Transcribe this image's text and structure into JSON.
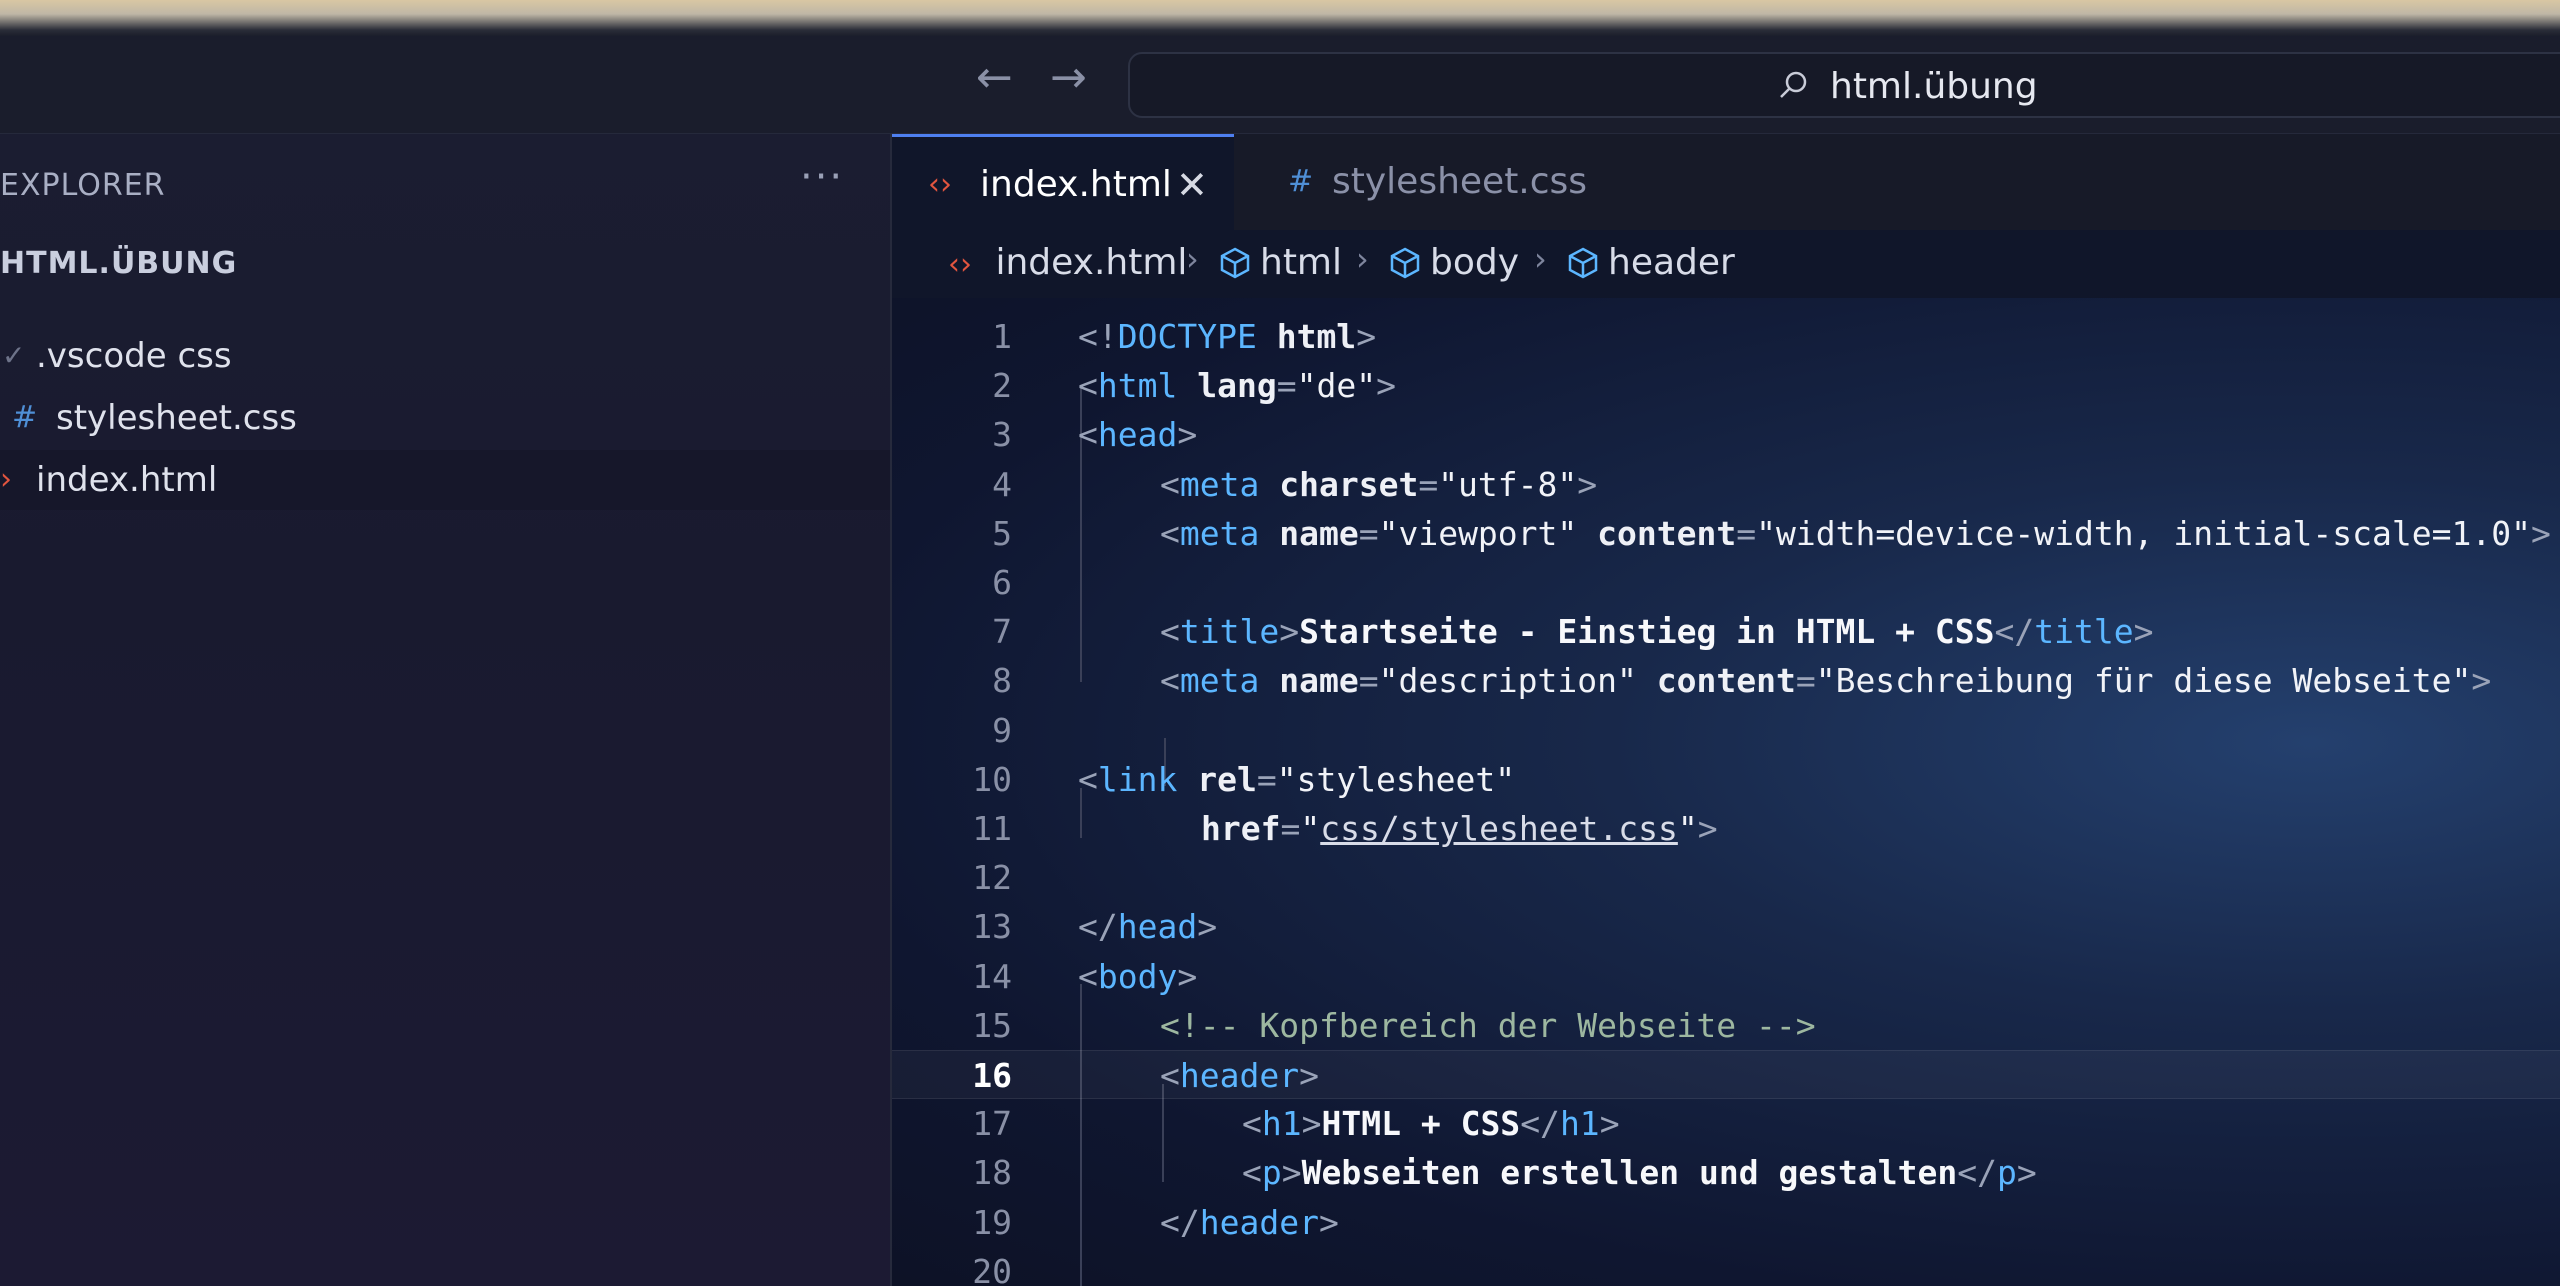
{
  "titlebar": {
    "search_text": "html.übung",
    "back_icon": "arrow-left-icon",
    "forward_icon": "arrow-right-icon"
  },
  "sidebar": {
    "header": "EXPLORER",
    "more": "···",
    "root": "HTML.ÜBUNG",
    "items": [
      {
        "label": ".vscode css",
        "icon": "folder-chevron-icon"
      },
      {
        "label": "stylesheet.css",
        "icon": "css-hash-icon"
      },
      {
        "label": "index.html",
        "icon": "html-icon"
      }
    ]
  },
  "tabs": [
    {
      "label": "index.html",
      "icon": "html-icon",
      "close": "✕",
      "active": true
    },
    {
      "label": "stylesheet.css",
      "icon": "css-hash-icon",
      "active": false
    }
  ],
  "breadcrumb": {
    "file": "index.html",
    "items": [
      "html",
      "body",
      "header"
    ]
  },
  "editor": {
    "current_line": 16,
    "lines": [
      {
        "n": "1",
        "indent": 0,
        "tokens": [
          [
            "p",
            "<!"
          ],
          [
            "tag",
            "DOCTYPE"
          ],
          [
            "p",
            " "
          ],
          [
            "attr",
            "html"
          ],
          [
            "p",
            ">"
          ]
        ]
      },
      {
        "n": "2",
        "indent": 0,
        "tokens": [
          [
            "p",
            "<"
          ],
          [
            "tag",
            "html"
          ],
          [
            "p",
            " "
          ],
          [
            "attr",
            "lang"
          ],
          [
            "p",
            "="
          ],
          [
            "str",
            "\"de\""
          ],
          [
            "p",
            ">"
          ]
        ]
      },
      {
        "n": "3",
        "indent": 0,
        "tokens": [
          [
            "p",
            "<"
          ],
          [
            "tag",
            "head"
          ],
          [
            "p",
            ">"
          ]
        ]
      },
      {
        "n": "4",
        "indent": 1,
        "tokens": [
          [
            "p",
            "<"
          ],
          [
            "tag",
            "meta"
          ],
          [
            "p",
            " "
          ],
          [
            "attr",
            "charset"
          ],
          [
            "p",
            "="
          ],
          [
            "str",
            "\"utf-8\""
          ],
          [
            "p",
            ">"
          ]
        ]
      },
      {
        "n": "5",
        "indent": 1,
        "tokens": [
          [
            "p",
            "<"
          ],
          [
            "tag",
            "meta"
          ],
          [
            "p",
            " "
          ],
          [
            "attr",
            "name"
          ],
          [
            "p",
            "="
          ],
          [
            "str",
            "\"viewport\""
          ],
          [
            "p",
            " "
          ],
          [
            "attr",
            "content"
          ],
          [
            "p",
            "="
          ],
          [
            "str",
            "\"width=device-width, initial-scale=1.0\""
          ],
          [
            "p",
            ">"
          ]
        ]
      },
      {
        "n": "6",
        "indent": 1,
        "tokens": []
      },
      {
        "n": "7",
        "indent": 1,
        "tokens": [
          [
            "p",
            "<"
          ],
          [
            "tag",
            "title"
          ],
          [
            "p",
            ">"
          ],
          [
            "txt",
            "Startseite - Einstieg in HTML + CSS"
          ],
          [
            "p",
            "</"
          ],
          [
            "tag",
            "title"
          ],
          [
            "p",
            ">"
          ]
        ]
      },
      {
        "n": "8",
        "indent": 1,
        "tokens": [
          [
            "p",
            "<"
          ],
          [
            "tag",
            "meta"
          ],
          [
            "p",
            " "
          ],
          [
            "attr",
            "name"
          ],
          [
            "p",
            "="
          ],
          [
            "str",
            "\"description\""
          ],
          [
            "p",
            " "
          ],
          [
            "attr",
            "content"
          ],
          [
            "p",
            "="
          ],
          [
            "str",
            "\"Beschreibung für diese Webseite\""
          ],
          [
            "p",
            ">"
          ]
        ]
      },
      {
        "n": "9",
        "indent": 1,
        "tokens": []
      },
      {
        "n": "10",
        "indent": 0,
        "tokens": [
          [
            "p",
            "<"
          ],
          [
            "tag",
            "link"
          ],
          [
            "p",
            " "
          ],
          [
            "attr",
            "rel"
          ],
          [
            "p",
            "="
          ],
          [
            "str",
            "\"stylesheet\""
          ]
        ]
      },
      {
        "n": "11",
        "indent": 1.5,
        "tokens": [
          [
            "attr",
            "href"
          ],
          [
            "p",
            "="
          ],
          [
            "str",
            "\""
          ],
          [
            "u",
            "css/stylesheet.css"
          ],
          [
            "str",
            "\""
          ],
          [
            "p",
            ">"
          ]
        ]
      },
      {
        "n": "12",
        "indent": 0,
        "tokens": []
      },
      {
        "n": "13",
        "indent": 0,
        "tokens": [
          [
            "p",
            "</"
          ],
          [
            "tag",
            "head"
          ],
          [
            "p",
            ">"
          ]
        ]
      },
      {
        "n": "14",
        "indent": 0,
        "tokens": [
          [
            "p",
            "<"
          ],
          [
            "tag",
            "body"
          ],
          [
            "p",
            ">"
          ]
        ]
      },
      {
        "n": "15",
        "indent": 1,
        "tokens": [
          [
            "cmt",
            "<!-- Kopfbereich der Webseite -->"
          ]
        ]
      },
      {
        "n": "16",
        "indent": 1,
        "tokens": [
          [
            "p",
            "<"
          ],
          [
            "tag",
            "header"
          ],
          [
            "p",
            ">"
          ]
        ]
      },
      {
        "n": "17",
        "indent": 2,
        "tokens": [
          [
            "p",
            "<"
          ],
          [
            "tag",
            "h1"
          ],
          [
            "p",
            ">"
          ],
          [
            "txt",
            "HTML + CSS"
          ],
          [
            "p",
            "</"
          ],
          [
            "tag",
            "h1"
          ],
          [
            "p",
            ">"
          ]
        ]
      },
      {
        "n": "18",
        "indent": 2,
        "tokens": [
          [
            "p",
            "<"
          ],
          [
            "tag",
            "p"
          ],
          [
            "p",
            ">"
          ],
          [
            "txt",
            "Webseiten erstellen und gestalten"
          ],
          [
            "p",
            "</"
          ],
          [
            "tag",
            "p"
          ],
          [
            "p",
            ">"
          ]
        ]
      },
      {
        "n": "19",
        "indent": 1,
        "tokens": [
          [
            "p",
            "</"
          ],
          [
            "tag",
            "header"
          ],
          [
            "p",
            ">"
          ]
        ]
      },
      {
        "n": "20",
        "indent": 1,
        "tokens": []
      }
    ]
  },
  "colors": {
    "tag": "#5cb6ff",
    "html_icon": "#e2553f",
    "css_icon": "#4f8fd6",
    "accent": "#4e7ff0"
  }
}
